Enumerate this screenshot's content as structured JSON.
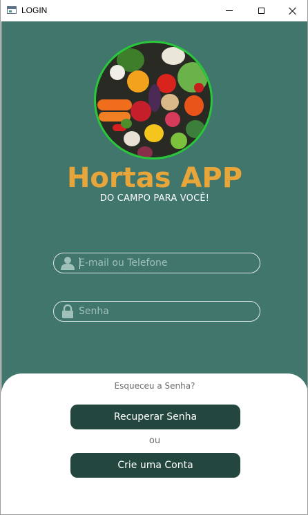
{
  "window": {
    "title": "LOGIN"
  },
  "branding": {
    "app_name": "Hortas APP",
    "tagline": "DO CAMPO PARA VOCÊ!",
    "logo_icon": "vegetables-image",
    "title_color": "#e8a53a"
  },
  "form": {
    "email": {
      "placeholder": "E-mail ou Telefone",
      "value": "",
      "icon": "user-icon"
    },
    "password": {
      "placeholder": "Senha",
      "value": "",
      "icon": "lock-icon"
    }
  },
  "actions": {
    "forgot_text": "Esqueceu a Senha?",
    "recover_label": "Recuperar Senha",
    "or_text": "ou",
    "create_label": "Crie uma Conta"
  },
  "colors": {
    "background": "#41766d",
    "button": "#23473f",
    "logo_ring": "#29c83a"
  }
}
